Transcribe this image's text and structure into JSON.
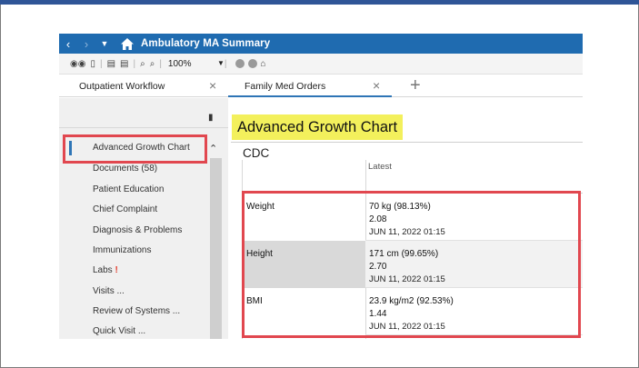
{
  "window": {
    "title": "Ambulatory MA Summary"
  },
  "toolbar": {
    "zoom": "100%"
  },
  "tabs": [
    {
      "label": "Outpatient Workflow"
    },
    {
      "label": "Family Med Orders"
    }
  ],
  "sidebar": {
    "items": [
      {
        "label": "Advanced Growth Chart"
      },
      {
        "label": "Documents (58)"
      },
      {
        "label": "Patient Education"
      },
      {
        "label": "Chief Complaint"
      },
      {
        "label": "Diagnosis & Problems"
      },
      {
        "label": "Immunizations"
      },
      {
        "label": "Labs"
      },
      {
        "label": "Visits ..."
      },
      {
        "label": "Review of Systems ..."
      },
      {
        "label": "Quick Visit ..."
      }
    ]
  },
  "content": {
    "title": "Advanced Growth Chart",
    "section": "CDC",
    "column_header": "Latest",
    "rows": [
      {
        "label": "Weight",
        "value": "70 kg (98.13%)",
        "z": "2.08",
        "date": "JUN 11, 2022 01:15"
      },
      {
        "label": "Height",
        "value": "171 cm (99.65%)",
        "z": "2.70",
        "date": "JUN 11, 2022 01:15"
      },
      {
        "label": "BMI",
        "value": "23.9 kg/m2 (92.53%)",
        "z": "1.44",
        "date": "JUN 11, 2022 01:15"
      }
    ]
  },
  "colors": {
    "titlebar": "#1f6bb0",
    "highlight_yellow": "#f3f05c",
    "annotation_red": "#e1474f",
    "accent_blue": "#2e75b6"
  },
  "icons": {
    "back": "chevron-left-icon",
    "forward": "chevron-right-icon",
    "menu": "caret-down-icon",
    "home": "home-icon",
    "labs_flag": "exclamation-icon"
  }
}
